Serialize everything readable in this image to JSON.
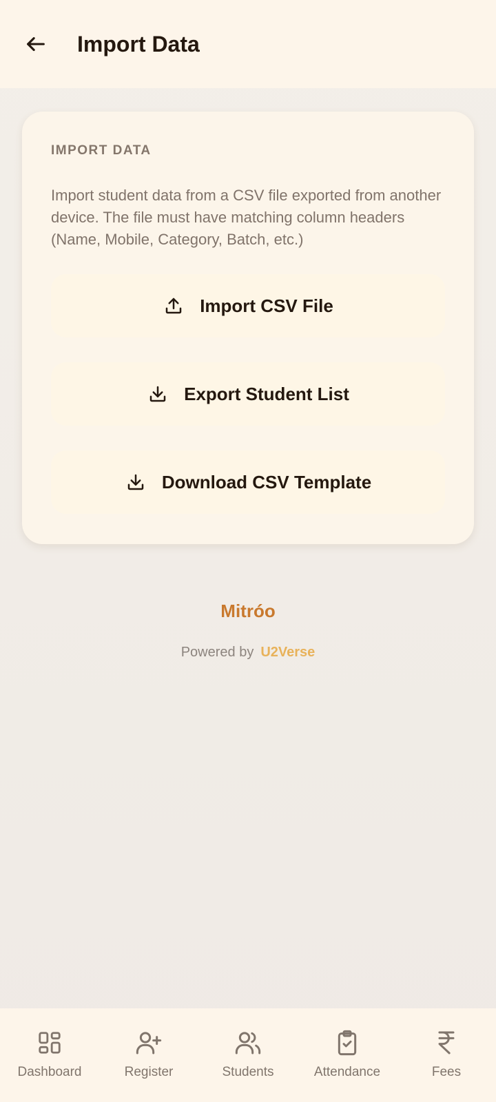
{
  "header": {
    "title": "Import Data",
    "back_icon": "arrow-left-icon"
  },
  "card": {
    "heading": "IMPORT DATA",
    "description": "Import student data from a CSV file exported from another device. The file must have matching column headers (Name, Mobile, Category, Batch, etc.)",
    "buttons": [
      {
        "label": "Import CSV File",
        "icon": "upload-icon"
      },
      {
        "label": "Export Student List",
        "icon": "download-icon"
      },
      {
        "label": "Download CSV Template",
        "icon": "download-icon"
      }
    ]
  },
  "footer": {
    "brand": "Mitróo",
    "powered_by": "Powered by",
    "company": "U2Verse"
  },
  "bottom_nav": {
    "items": [
      {
        "label": "Dashboard",
        "icon": "grid-icon"
      },
      {
        "label": "Register",
        "icon": "user-plus-icon"
      },
      {
        "label": "Students",
        "icon": "users-icon"
      },
      {
        "label": "Attendance",
        "icon": "clipboard-check-icon"
      },
      {
        "label": "Fees",
        "icon": "rupee-icon"
      }
    ]
  },
  "colors": {
    "accent": "#c9792e",
    "company": "#e8b25a",
    "surface": "#fdf5ea",
    "card": "#fcf5ea",
    "button": "#fef6e6"
  }
}
